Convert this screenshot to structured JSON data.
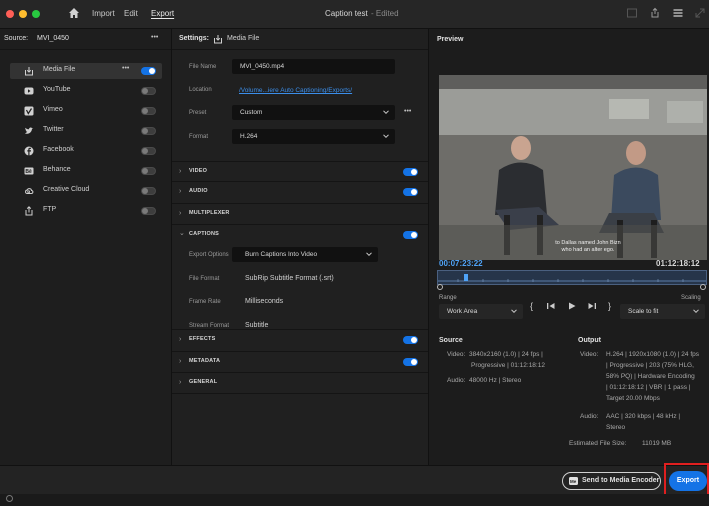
{
  "window": {
    "title": "Caption test",
    "title_state": "- Edited",
    "menus": [
      "Import",
      "Edit",
      "Export"
    ]
  },
  "source": {
    "label": "Source:",
    "name": "MVI_0450",
    "more": "•••"
  },
  "destinations": [
    {
      "label": "Media File",
      "icon": "media-file-icon",
      "enabled": true
    },
    {
      "label": "YouTube",
      "icon": "youtube-icon",
      "enabled": false
    },
    {
      "label": "Vimeo",
      "icon": "vimeo-icon",
      "enabled": false
    },
    {
      "label": "Twitter",
      "icon": "twitter-icon",
      "enabled": false
    },
    {
      "label": "Facebook",
      "icon": "facebook-icon",
      "enabled": false
    },
    {
      "label": "Behance",
      "icon": "behance-icon",
      "enabled": false
    },
    {
      "label": "Creative Cloud",
      "icon": "creative-cloud-icon",
      "enabled": false
    },
    {
      "label": "FTP",
      "icon": "ftp-icon",
      "enabled": false
    }
  ],
  "settings": {
    "header": "Settings:",
    "header_target": "Media File",
    "file_name_label": "File Name",
    "file_name": "MVI_0450.mp4",
    "location_label": "Location",
    "location": "/Volume...iere Auto Captioning/Exports/",
    "preset_label": "Preset",
    "preset": "Custom",
    "format_label": "Format",
    "format": "H.264",
    "sections": {
      "video": "VIDEO",
      "audio": "AUDIO",
      "multiplexer": "MULTIPLEXER",
      "captions": "CAPTIONS",
      "effects": "EFFECTS",
      "metadata": "METADATA",
      "general": "GENERAL"
    },
    "captions": {
      "export_options_label": "Export Options",
      "export_options": "Burn Captions Into Video",
      "file_format_label": "File Format",
      "file_format": "SubRip Subtitle Format (.srt)",
      "frame_rate_label": "Frame Rate",
      "frame_rate": "Milliseconds",
      "stream_format_label": "Stream Format",
      "stream_format": "Subtitle"
    }
  },
  "preview": {
    "title": "Preview",
    "caption_line1": "to Dallas named John Bizn",
    "caption_line2": "who had an alter ego.",
    "current_time": "00:07:23:22",
    "duration": "01:12:18:12",
    "range_label": "Range",
    "range_value": "Work Area",
    "scaling_label": "Scaling",
    "scaling_value": "Scale to fit"
  },
  "source_info": {
    "title": "Source",
    "video_label": "Video:",
    "video_line1": "3840x2160 (1.0) | 24 fps |",
    "video_line2": "Progressive | 01:12:18:12",
    "audio_label": "Audio:",
    "audio": "48000 Hz | Stereo"
  },
  "output_info": {
    "title": "Output",
    "video_label": "Video:",
    "video_lines": [
      "H.264 | 1920x1080 (1.0) | 24 fps",
      "| Progressive | 203 (75% HLG,",
      "58% PQ) | Hardware Encoding",
      "| 01:12:18:12 | VBR | 1 pass |",
      "Target 20.00 Mbps"
    ],
    "audio_label": "Audio:",
    "audio_lines": [
      "AAC | 320 kbps | 48 kHz |",
      "Stereo"
    ],
    "file_size_label": "Estimated File Size:",
    "file_size": "11019 MB"
  },
  "footer": {
    "send_label": "Send to Media Encoder",
    "export_label": "Export"
  },
  "colors": {
    "accent": "#1473e6",
    "timecode": "#4fa3f7",
    "highlight_box": "#e01f1f"
  }
}
